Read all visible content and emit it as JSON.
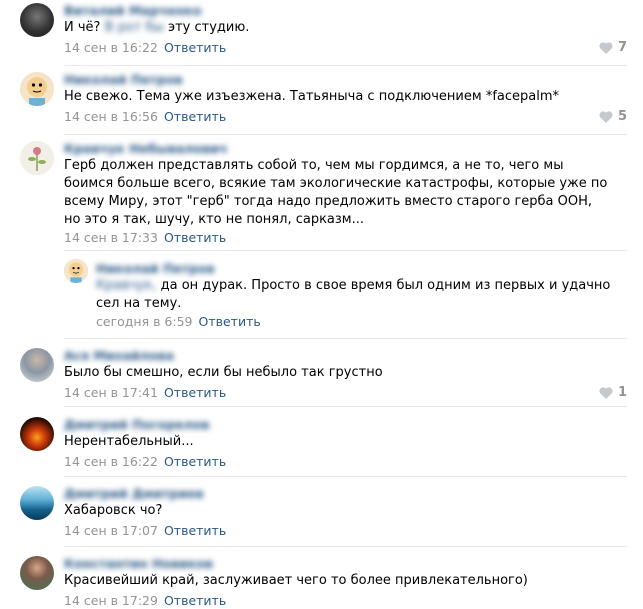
{
  "colors": {
    "link": "#2a5885",
    "muted": "#939393",
    "separator": "#e7e8ec"
  },
  "reply_label": "Ответить",
  "comments": [
    {
      "name": "Виталий Марченко",
      "text_before": "И чё? ",
      "text_blurred": "В рот бы",
      "text_after": " эту студию.",
      "date": "14 сен в 16:22",
      "likes": "7",
      "avatar_icon": "user-photo-dark"
    },
    {
      "name": "Николай Петров",
      "text": "Не свежо. Тема уже изъезжена. Татьяныча с подключением *facepalm*",
      "date": "14 сен в 16:56",
      "likes": "5",
      "avatar_icon": "cartoon-face-avatar"
    },
    {
      "name": "Кравчук Небывалович",
      "text": "Герб должен представлять собой то, чем мы гордимся, а не то, чего мы боимся больше всего, всякие там экологические катастрофы, которые уже по всему Миру, этот \"герб\" тогда надо предложить вместо старого герба ООН, но это я так, шучу, кто не понял, сарказм...",
      "date": "14 сен в 17:33",
      "avatar_icon": "flower-drawing-avatar"
    },
    {
      "name": "Николай Петров",
      "reply_to": "Кравчук,",
      "text": "да он дурак. Просто в свое время был одним из первых и удачно сел на тему.",
      "date": "сегодня в 6:59",
      "avatar_icon": "cartoon-face-avatar"
    },
    {
      "name": "Ася Михайлова",
      "text": "Было бы смешно, если бы небыло так грустно",
      "date": "14 сен в 17:41",
      "likes": "1",
      "avatar_icon": "user-photo"
    },
    {
      "name": "Дмитрий Погорелов",
      "text": "Нерентабельный...",
      "date": "14 сен в 16:22",
      "avatar_icon": "fire-avatar"
    },
    {
      "name": "Дмитрий Дмитриев",
      "text": "Хабаровск чо?",
      "date": "14 сен в 17:07",
      "avatar_icon": "landscape-avatar"
    },
    {
      "name": "Константин Новиков",
      "text": "Красивейший край, заслуживает чего то более привлекательного)",
      "date": "14 сен в 17:29",
      "avatar_icon": "user-photo-man"
    }
  ]
}
